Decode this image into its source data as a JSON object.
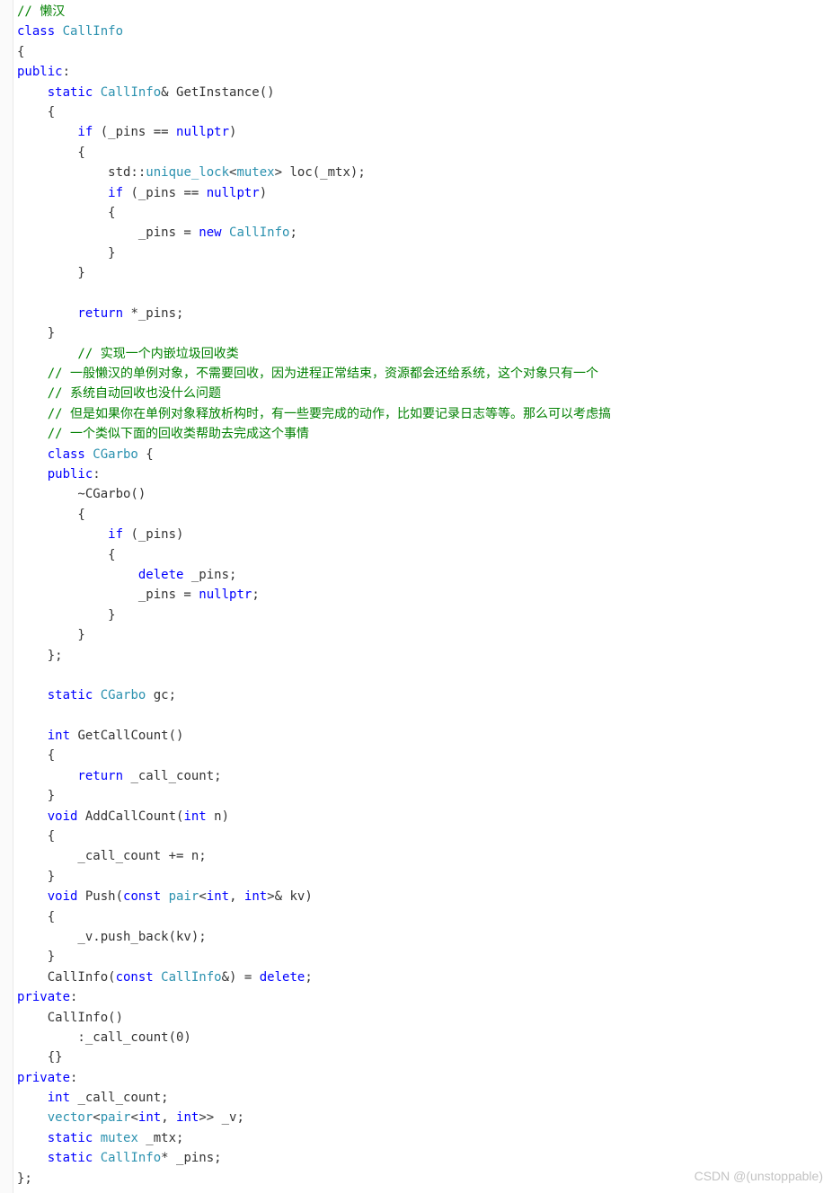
{
  "watermark": "CSDN @(unstoppable)",
  "code": {
    "l01": "// 懒汉",
    "l02a": "class",
    "l02b": " CallInfo",
    "l03": "{",
    "l04a": "public",
    "l04b": ":",
    "l05a": "    static",
    "l05b": " CallInfo",
    "l05c": "& GetInstance()",
    "l06": "    {",
    "l07a": "        if",
    "l07b": " (_pins == ",
    "l07c": "nullptr",
    "l07d": ")",
    "l08": "        {",
    "l09a": "            std::",
    "l09b": "unique_lock",
    "l09c": "<",
    "l09d": "mutex",
    "l09e": "> loc(_mtx);",
    "l10a": "            if",
    "l10b": " (_pins == ",
    "l10c": "nullptr",
    "l10d": ")",
    "l11": "            {",
    "l12a": "                _pins = ",
    "l12b": "new",
    "l12c": " CallInfo",
    "l12d": ";",
    "l13": "            }",
    "l14": "        }",
    "l15": "",
    "l16a": "        return",
    "l16b": " *_pins;",
    "l17": "    }",
    "l18": "        // 实现一个内嵌垃圾回收类",
    "l19": "    // 一般懒汉的单例对象，不需要回收，因为进程正常结束，资源都会还给系统，这个对象只有一个",
    "l20": "    // 系统自动回收也没什么问题",
    "l21": "    // 但是如果你在单例对象释放析构时，有一些要完成的动作，比如要记录日志等等。那么可以考虑搞",
    "l22": "    // 一个类似下面的回收类帮助去完成这个事情",
    "l23a": "    class",
    "l23b": " CGarbo",
    "l23c": " {",
    "l24a": "    public",
    "l24b": ":",
    "l25": "        ~CGarbo()",
    "l26": "        {",
    "l27a": "            if",
    "l27b": " (_pins)",
    "l28": "            {",
    "l29a": "                delete",
    "l29b": " _pins;",
    "l30a": "                _pins = ",
    "l30b": "nullptr",
    "l30c": ";",
    "l31": "            }",
    "l32": "        }",
    "l33": "    };",
    "l34": "",
    "l35a": "    static",
    "l35b": " CGarbo",
    "l35c": " gc;",
    "l36": "",
    "l37a": "    int",
    "l37b": " GetCallCount()",
    "l38": "    {",
    "l39a": "        return",
    "l39b": " _call_count;",
    "l40": "    }",
    "l41a": "    void",
    "l41b": " AddCallCount(",
    "l41c": "int",
    "l41d": " n)",
    "l42": "    {",
    "l43": "        _call_count += n;",
    "l44": "    }",
    "l45a": "    void",
    "l45b": " Push(",
    "l45c": "const",
    "l45d": " pair",
    "l45e": "<",
    "l45f": "int",
    "l45g": ", ",
    "l45h": "int",
    "l45i": ">& kv)",
    "l46": "    {",
    "l47": "        _v.push_back(kv);",
    "l48": "    }",
    "l49a": "    CallInfo(",
    "l49b": "const",
    "l49c": " CallInfo",
    "l49d": "&) = ",
    "l49e": "delete",
    "l49f": ";",
    "l50a": "private",
    "l50b": ":",
    "l51": "    CallInfo()",
    "l52": "        :_call_count(0)",
    "l53": "    {}",
    "l54a": "private",
    "l54b": ":",
    "l55a": "    int",
    "l55b": " _call_count;",
    "l56a": "    vector",
    "l56b": "<",
    "l56c": "pair",
    "l56d": "<",
    "l56e": "int",
    "l56f": ", ",
    "l56g": "int",
    "l56h": ">> _v;",
    "l57a": "    static",
    "l57b": " mutex",
    "l57c": " _mtx;",
    "l58a": "    static",
    "l58b": " CallInfo",
    "l58c": "* _pins;",
    "l59": "};"
  }
}
